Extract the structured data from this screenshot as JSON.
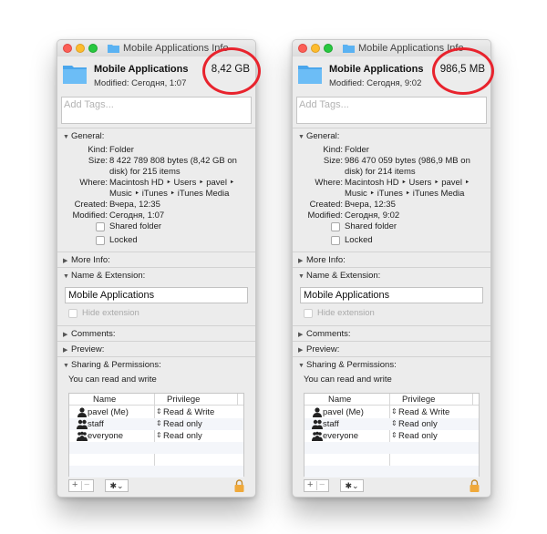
{
  "windows": [
    {
      "title": "Mobile Applications Info",
      "name": "Mobile Applications",
      "modified_header": "Modified: Сегодня, 1:07",
      "size_header": "8,42 GB",
      "tags_placeholder": "Add Tags...",
      "sections": {
        "general": "General:",
        "more_info": "More Info:",
        "name_ext": "Name & Extension:",
        "comments": "Comments:",
        "preview": "Preview:",
        "sharing": "Sharing & Permissions:"
      },
      "general": {
        "kind_label": "Kind:",
        "kind": "Folder",
        "size_label": "Size:",
        "size_1": "8 422 789 808 bytes (8,42 GB on",
        "size_2": "disk) for 215 items",
        "where_label": "Where:",
        "where_1": "Macintosh HD ‣ Users ‣ pavel ‣",
        "where_2": "Music ‣ iTunes ‣ iTunes Media",
        "created_label": "Created:",
        "created": "Вчера, 12:35",
        "modified_label": "Modified:",
        "modified": "Сегодня, 1:07",
        "shared_folder": "Shared folder",
        "locked": "Locked"
      },
      "name_field": "Mobile Applications",
      "hide_extension": "Hide extension",
      "sharing_note": "You can read and write",
      "perm_headers": {
        "name": "Name",
        "privilege": "Privilege"
      },
      "permissions": [
        {
          "name": "pavel (Me)",
          "privilege": "Read & Write"
        },
        {
          "name": "staff",
          "privilege": "Read only"
        },
        {
          "name": "everyone",
          "privilege": "Read only"
        }
      ],
      "gear_label": "✱⌄"
    },
    {
      "title": "Mobile Applications Info",
      "name": "Mobile Applications",
      "modified_header": "Modified: Сегодня, 9:02",
      "size_header": "986,5 MB",
      "tags_placeholder": "Add Tags...",
      "sections": {
        "general": "General:",
        "more_info": "More Info:",
        "name_ext": "Name & Extension:",
        "comments": "Comments:",
        "preview": "Preview:",
        "sharing": "Sharing & Permissions:"
      },
      "general": {
        "kind_label": "Kind:",
        "kind": "Folder",
        "size_label": "Size:",
        "size_1": "986 470 059 bytes (986,9 MB on",
        "size_2": "disk) for 214 items",
        "where_label": "Where:",
        "where_1": "Macintosh HD ‣ Users ‣ pavel ‣",
        "where_2": "Music ‣ iTunes ‣ iTunes Media",
        "created_label": "Created:",
        "created": "Вчера, 12:35",
        "modified_label": "Modified:",
        "modified": "Сегодня, 9:02",
        "shared_folder": "Shared folder",
        "locked": "Locked"
      },
      "name_field": "Mobile Applications",
      "hide_extension": "Hide extension",
      "sharing_note": "You can read and write",
      "perm_headers": {
        "name": "Name",
        "privilege": "Privilege"
      },
      "permissions": [
        {
          "name": "pavel (Me)",
          "privilege": "Read & Write"
        },
        {
          "name": "staff",
          "privilege": "Read only"
        },
        {
          "name": "everyone",
          "privilege": "Read only"
        }
      ],
      "gear_label": "✱⌄"
    }
  ],
  "colors": {
    "folder": "#5ab2f2",
    "highlight_circle": "#e8232d"
  }
}
